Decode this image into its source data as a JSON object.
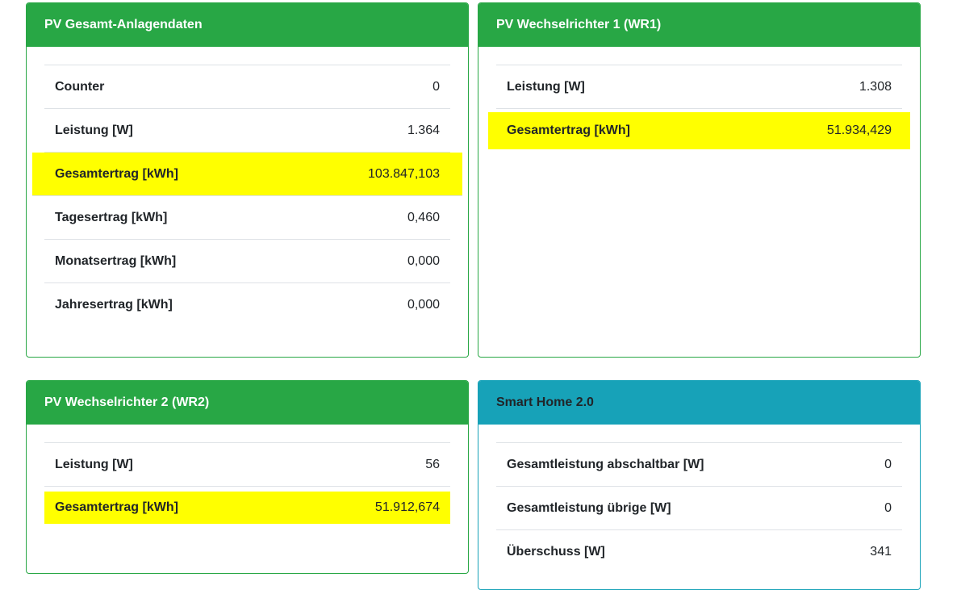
{
  "cards": [
    {
      "title": "PV Gesamt-Anlagendaten",
      "rows": [
        {
          "label": "Counter",
          "value": "0"
        },
        {
          "label": "Leistung [W]",
          "value": "1.364"
        },
        {
          "label": "Gesamtertrag [kWh]",
          "value": "103.847,103"
        },
        {
          "label": "Tagesertrag [kWh]",
          "value": "0,460"
        },
        {
          "label": "Monatsertrag [kWh]",
          "value": "0,000"
        },
        {
          "label": "Jahresertrag [kWh]",
          "value": "0,000"
        }
      ]
    },
    {
      "title": "PV Wechselrichter 1 (WR1)",
      "rows": [
        {
          "label": "Leistung [W]",
          "value": "1.308"
        },
        {
          "label": "Gesamtertrag [kWh]",
          "value": "51.934,429"
        }
      ]
    },
    {
      "title": "PV Wechselrichter 2 (WR2)",
      "rows": [
        {
          "label": "Leistung [W]",
          "value": "56"
        },
        {
          "label": "Gesamtertrag [kWh]",
          "value": "51.912,674"
        }
      ]
    },
    {
      "title": "Smart Home 2.0",
      "rows": [
        {
          "label": "Gesamtleistung abschaltbar [W]",
          "value": "0"
        },
        {
          "label": "Gesamtleistung übrige [W]",
          "value": "0"
        },
        {
          "label": "Überschuss [W]",
          "value": "341"
        }
      ]
    }
  ],
  "colors": {
    "success": "#28a745",
    "info": "#17a2b8",
    "highlight": "#ffff00"
  }
}
